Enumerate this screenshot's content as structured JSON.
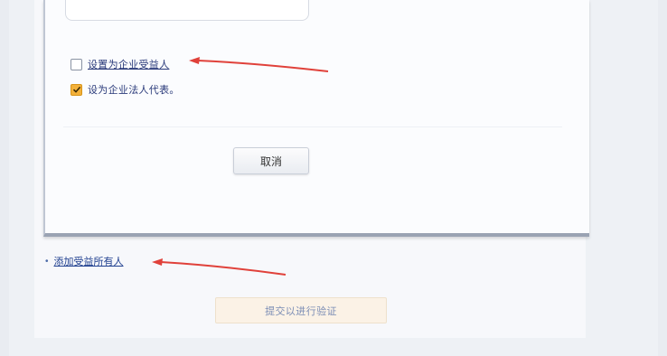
{
  "dialog": {
    "options": [
      {
        "label": "设置为企业受益人",
        "checked": false
      },
      {
        "label": "设为企业法人代表。",
        "checked": true
      }
    ],
    "cancel_label": "取消"
  },
  "page": {
    "link_label": "添加受益所有人",
    "submit_label": "提交以进行验证"
  },
  "colors": {
    "annotation_arrow": "#e0413a",
    "checkbox_checked": "#f3b13a",
    "link": "#1f3f8f"
  }
}
